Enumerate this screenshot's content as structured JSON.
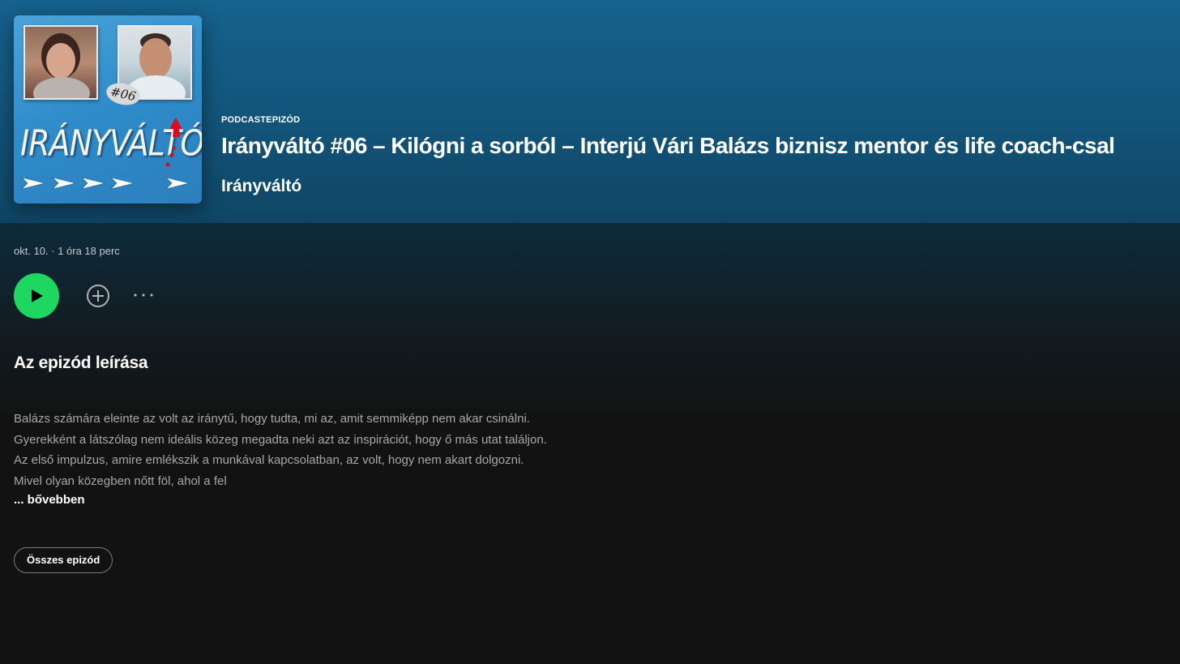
{
  "episode": {
    "kicker": "PODCASTEPIZÓD",
    "title": "Irányváltó #06 – Kilógni a sorból – Interjú Vári Balázs biznisz mentor és life coach-csal",
    "show_name": "Irányváltó",
    "meta": "okt. 10. · 1 óra 18 perc"
  },
  "cover": {
    "badge": "#06",
    "wordmark": "IRÁNYVÁLTÓ"
  },
  "actions": {
    "play_icon": "play-icon",
    "add_icon": "plus-circle-icon",
    "more_icon": "more-dots-icon"
  },
  "description": {
    "heading": "Az epizód leírása",
    "text": "Balázs számára eleinte az volt az iránytű, hogy tudta, mi az, amit semmiképp nem akar csinálni. Gyerekként a látszólag nem ideális közeg megadta neki azt az inspirációt, hogy ő más utat találjon. Az első impulzus, amire emlékszik a munkával kapcsolatban, az volt, hogy nem akart dolgozni. Mivel olyan közegben nőtt föl, ahol a fel",
    "more_label": "... bővebben"
  },
  "all_episodes_label": "Összes epizód",
  "colors": {
    "accent": "#1ed760",
    "header": "#16628f",
    "background": "#121212",
    "muted_text": "#a7a7a7"
  }
}
